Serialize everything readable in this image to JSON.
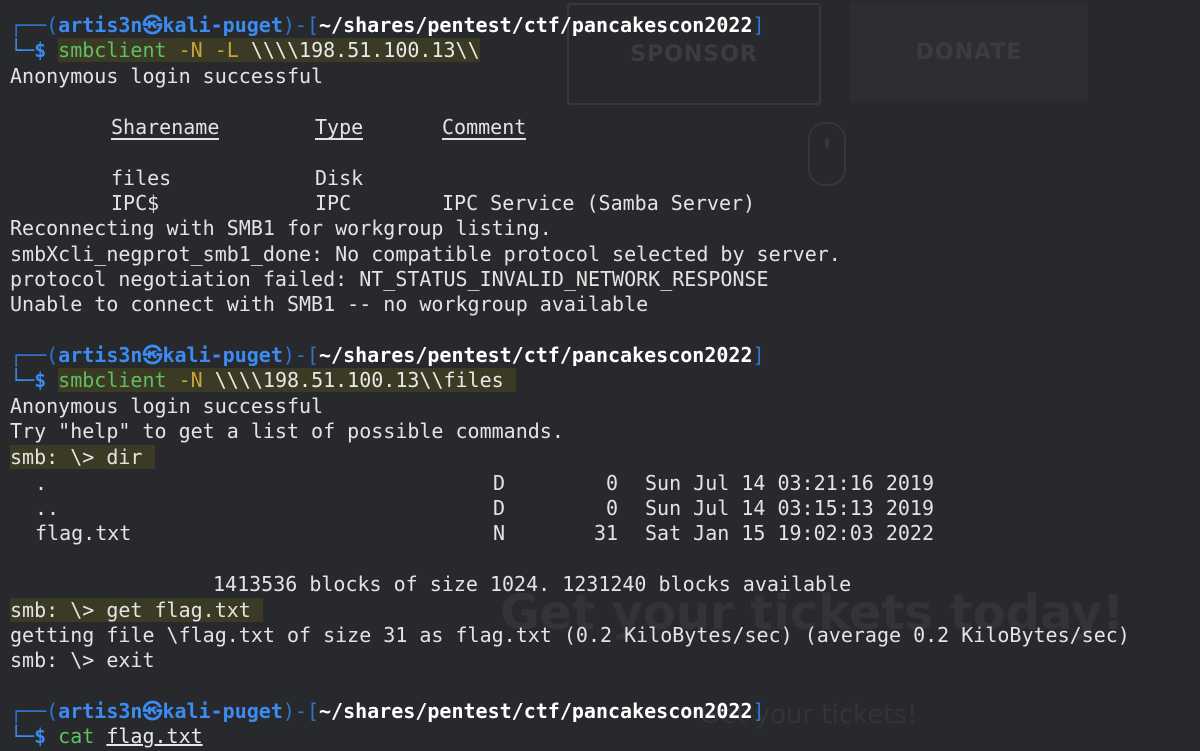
{
  "background": {
    "sponsor_label": "SPONSOR",
    "donate_label": "DONATE",
    "headline": "Get your tickets today!",
    "subline": "Get your tickets!"
  },
  "prompt": {
    "user": "artis3n",
    "at": "㉿",
    "host": "kali-puget",
    "path": "~/shares/pentest/ctf/pancakescon2022",
    "frame_top_left": "┌──(",
    "frame_mid": ")-[",
    "frame_end": "]",
    "frame_bottom": "└─$ "
  },
  "commands": {
    "cmd1": {
      "program": "smbclient",
      "flags": "-N -L",
      "arg": "\\\\\\\\198.51.100.13\\\\"
    },
    "cmd2": {
      "program": "smbclient",
      "flags": "-N",
      "arg": "\\\\\\\\198.51.100.13\\\\files"
    },
    "cmd3": {
      "program": "cat",
      "arg": "flag.txt"
    }
  },
  "smb_prompt": "smb: \\> ",
  "smb_commands": {
    "dir": "dir",
    "get": "get flag.txt",
    "exit": "exit"
  },
  "output": {
    "anon_login": "Anonymous login successful",
    "share_headers": {
      "sharename": "Sharename",
      "type": "Type",
      "comment": "Comment"
    },
    "shares": [
      {
        "name": "files",
        "type": "Disk",
        "comment": ""
      },
      {
        "name": "IPC$",
        "type": "IPC",
        "comment": "IPC Service (Samba Server)"
      }
    ],
    "reconnect": "Reconnecting with SMB1 for workgroup listing.",
    "negprot": "smbXcli_negprot_smb1_done: No compatible protocol selected by server.",
    "negotiation_failed": "protocol negotiation failed: NT_STATUS_INVALID_NETWORK_RESPONSE",
    "unable_connect": "Unable to connect with SMB1 -- no workgroup available",
    "help_hint": "Try \"help\" to get a list of possible commands.",
    "dir_entries": [
      {
        "name": ".",
        "attr": "D",
        "size": "0",
        "date": "Sun Jul 14 03:21:16 2019"
      },
      {
        "name": "..",
        "attr": "D",
        "size": "0",
        "date": "Sun Jul 14 03:15:13 2019"
      },
      {
        "name": "flag.txt",
        "attr": "N",
        "size": "31",
        "date": "Sat Jan 15 19:02:03 2022"
      }
    ],
    "blocks": "1413536 blocks of size 1024. 1231240 blocks available",
    "getting_file": "getting file \\flag.txt of size 31 as flag.txt (0.2 KiloBytes/sec) (average 0.2 KiloBytes/sec)"
  }
}
